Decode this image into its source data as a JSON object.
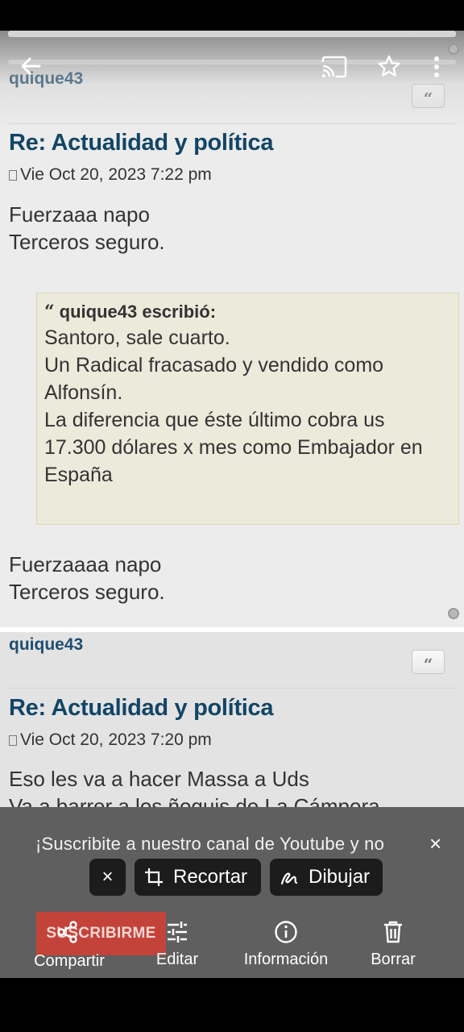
{
  "forum": {
    "posts": [
      {
        "username": "quique43",
        "quote_button": "“",
        "title": "Re: Actualidad y política",
        "date": "Vie Oct 20, 2023 7:22 pm",
        "body_top": [
          "Fuerzaaa napo",
          "Terceros seguro."
        ],
        "quote": {
          "author": "quique43 escribió:",
          "text": "Santoro, sale cuarto.\nUn Radical fracasado y vendido como\nAlfonsín.\nLa diferencia que éste último cobra us\n17.300 dólares x mes como Embajador en\nEspaña"
        },
        "body_bottom": [
          "Fuerzaaaa napo",
          "Terceros seguro."
        ]
      },
      {
        "username": "quique43",
        "quote_button": "“",
        "title": "Re: Actualidad y política",
        "date": "Vie Oct 20, 2023 7:20 pm",
        "body_top": [
          "Eso les va a hacer Massa a Uds",
          "Va a barrer a los ñoquis de La Cámpora"
        ]
      }
    ]
  },
  "viewer_toolbar": {
    "icons": [
      "back-arrow-icon",
      "cast-icon",
      "star-icon",
      "more-vert-icon"
    ]
  },
  "overlay": {
    "banner_text": "¡Suscribite a nuestro canal de Youtube y no",
    "banner_close": "×",
    "subscribe_label": "SUSCRIBIRME",
    "chips": {
      "close": "×",
      "crop": "Recortar",
      "draw": "Dibujar"
    },
    "actions": {
      "share": "Compartir",
      "edit": "Editar",
      "info": "Información",
      "delete": "Borrar"
    }
  },
  "colors": {
    "title": "#124566",
    "username": "#1e4e70",
    "quote_bg": "#ebeadb",
    "subscribe_bg": "#c3433a",
    "panel_bg": "#5f5f5f"
  }
}
